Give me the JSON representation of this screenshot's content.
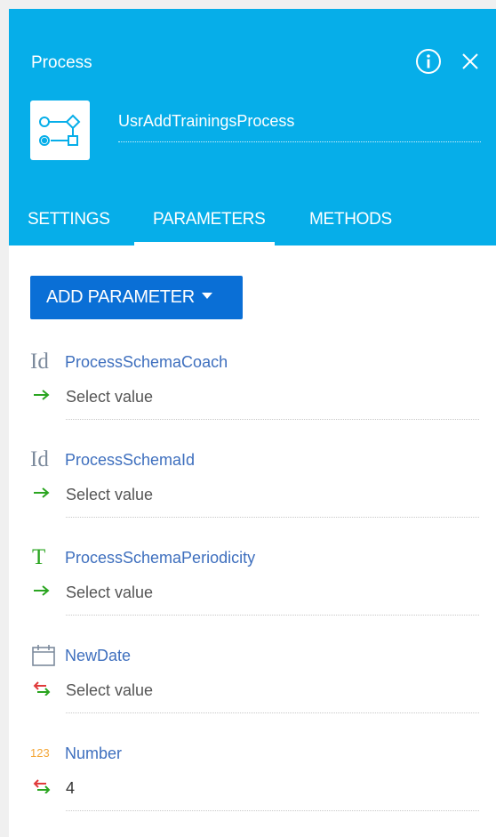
{
  "header": {
    "title": "Process",
    "process_name": "UsrAddTrainingsProcess",
    "background_color": "#06aee9",
    "icons": [
      "info-icon",
      "close-icon",
      "process-diagram-icon"
    ]
  },
  "tabs": [
    {
      "label": "SETTINGS",
      "active": false
    },
    {
      "label": "PARAMETERS",
      "active": true
    },
    {
      "label": "METHODS",
      "active": false
    }
  ],
  "toolbar": {
    "add_parameter_label": "ADD PARAMETER",
    "button_color": "#0a6fd6"
  },
  "parameters": [
    {
      "type_label": "Id",
      "type_icon": "id-type-icon",
      "name": "ProcessSchemaCoach",
      "direction_icon": "input-arrow-icon",
      "value": "Select value"
    },
    {
      "type_label": "Id",
      "type_icon": "id-type-icon",
      "name": "ProcessSchemaId",
      "direction_icon": "input-arrow-icon",
      "value": "Select value"
    },
    {
      "type_label": "T",
      "type_icon": "text-type-icon",
      "name": "ProcessSchemaPeriodicity",
      "direction_icon": "input-arrow-icon",
      "value": "Select value"
    },
    {
      "type_label": "",
      "type_icon": "calendar-icon",
      "name": "NewDate",
      "direction_icon": "bidirectional-arrows-icon",
      "value": "Select value"
    },
    {
      "type_label": "123",
      "type_icon": "number-type-icon",
      "name": "Number",
      "direction_icon": "bidirectional-arrows-icon",
      "value": "4"
    }
  ]
}
